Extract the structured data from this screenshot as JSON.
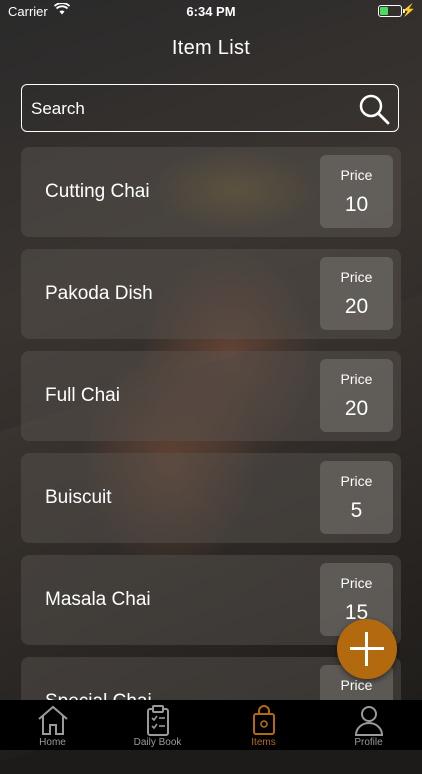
{
  "status": {
    "carrier": "Carrier",
    "time": "6:34 PM"
  },
  "title": "Item List",
  "search": {
    "placeholder": "Search"
  },
  "items": [
    {
      "name": "Cutting Chai",
      "price_label": "Price",
      "price": "10"
    },
    {
      "name": "Pakoda Dish",
      "price_label": "Price",
      "price": "20"
    },
    {
      "name": "Full Chai",
      "price_label": "Price",
      "price": "20"
    },
    {
      "name": "Buiscuit",
      "price_label": "Price",
      "price": "5"
    },
    {
      "name": "Masala Chai",
      "price_label": "Price",
      "price": "15"
    },
    {
      "name": "Special Chai",
      "price_label": "Price",
      "price": ""
    }
  ],
  "tabs": [
    {
      "label": "Home",
      "icon": "home-icon"
    },
    {
      "label": "Daily Book",
      "icon": "clipboard-icon"
    },
    {
      "label": "Items",
      "icon": "bag-icon"
    },
    {
      "label": "Profile",
      "icon": "person-icon"
    }
  ],
  "colors": {
    "accent": "#b3690d",
    "battery": "#4cd964"
  }
}
